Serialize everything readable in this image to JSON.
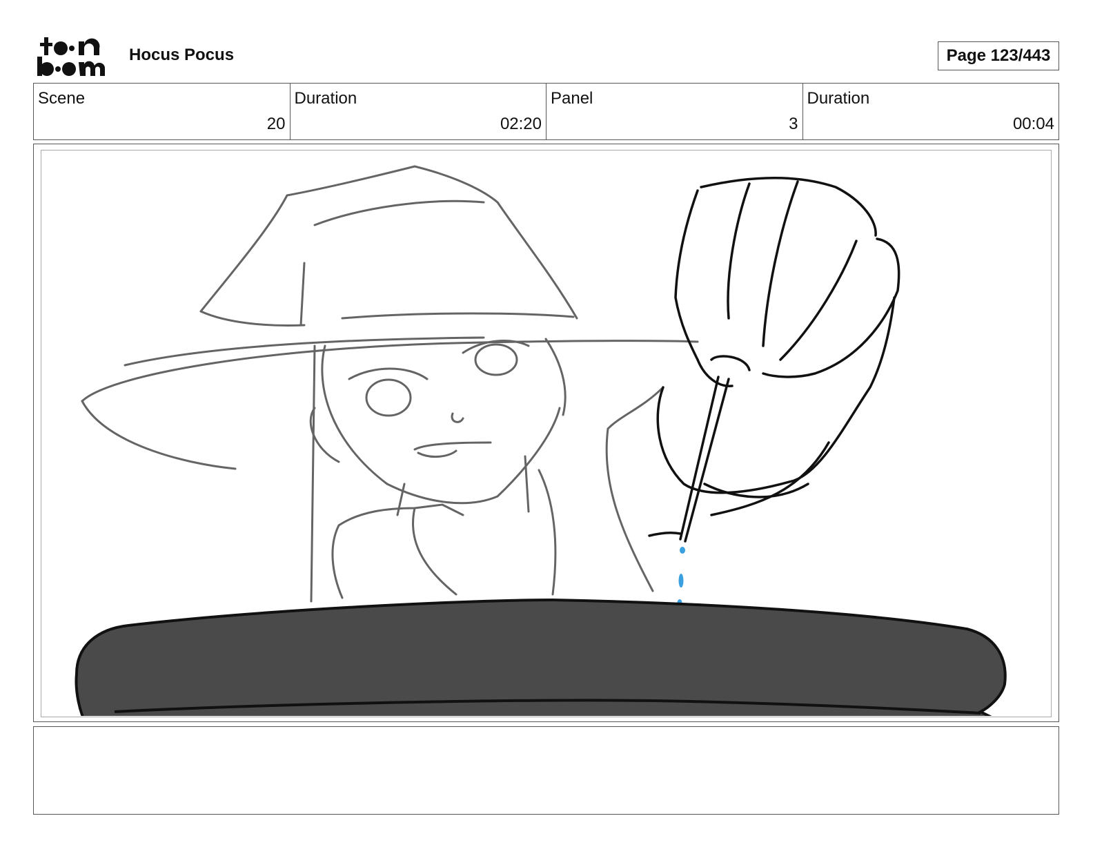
{
  "header": {
    "logo_text": "toonboom",
    "project_title": "Hocus Pocus",
    "page_indicator": "Page 123/443"
  },
  "info": {
    "scene_label": "Scene",
    "scene_value": "20",
    "scene_duration_label": "Duration",
    "scene_duration_value": "02:20",
    "panel_label": "Panel",
    "panel_value": "3",
    "panel_duration_label": "Duration",
    "panel_duration_value": "00:04"
  },
  "panel": {
    "image_description_icon": "storyboard-sketch",
    "drop_color": "#3aa0e0",
    "cauldron_color": "#4a4a4a"
  },
  "notes": {
    "text": ""
  }
}
